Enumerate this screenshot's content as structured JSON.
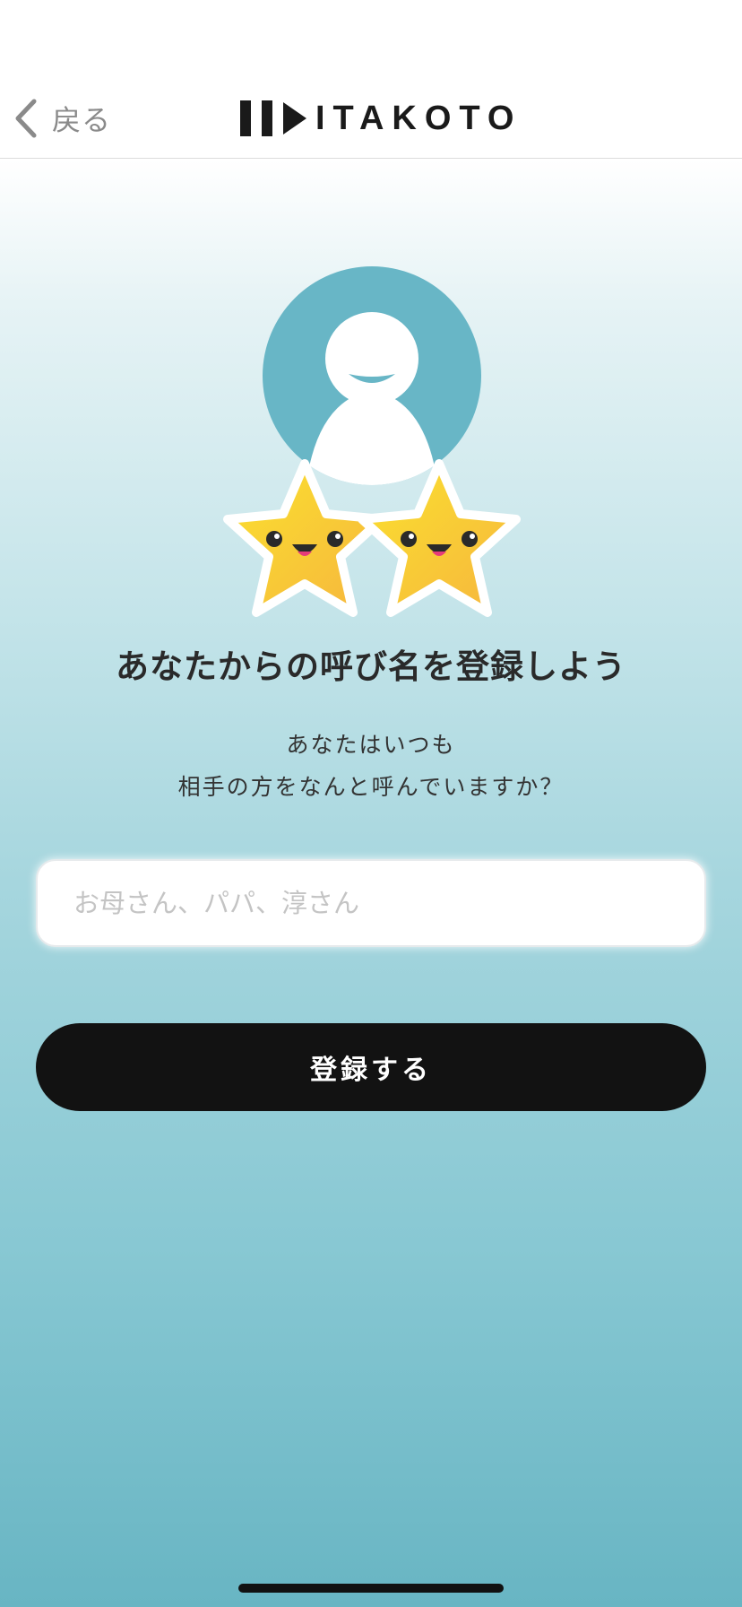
{
  "nav": {
    "back_label": "戻る",
    "logo_text": "ITAKOTO"
  },
  "registration": {
    "heading": "あなたからの呼び名を登録しよう",
    "subtitle_line1": "あなたはいつも",
    "subtitle_line2": "相手の方をなんと呼んでいますか？",
    "input_placeholder": "お母さん、パパ、淳さん",
    "input_value": "",
    "submit_label": "登録する"
  },
  "icons": [
    "back-chevron-icon",
    "itakoto-logo-icon",
    "person-avatar-icon",
    "smiling-star-icon"
  ],
  "colors": {
    "avatar_bg": "#68b6c6",
    "button_bg": "#121212",
    "button_text": "#ffffff",
    "star_fill": "#f7c93a",
    "gradient_bottom": "#68b5c3"
  }
}
